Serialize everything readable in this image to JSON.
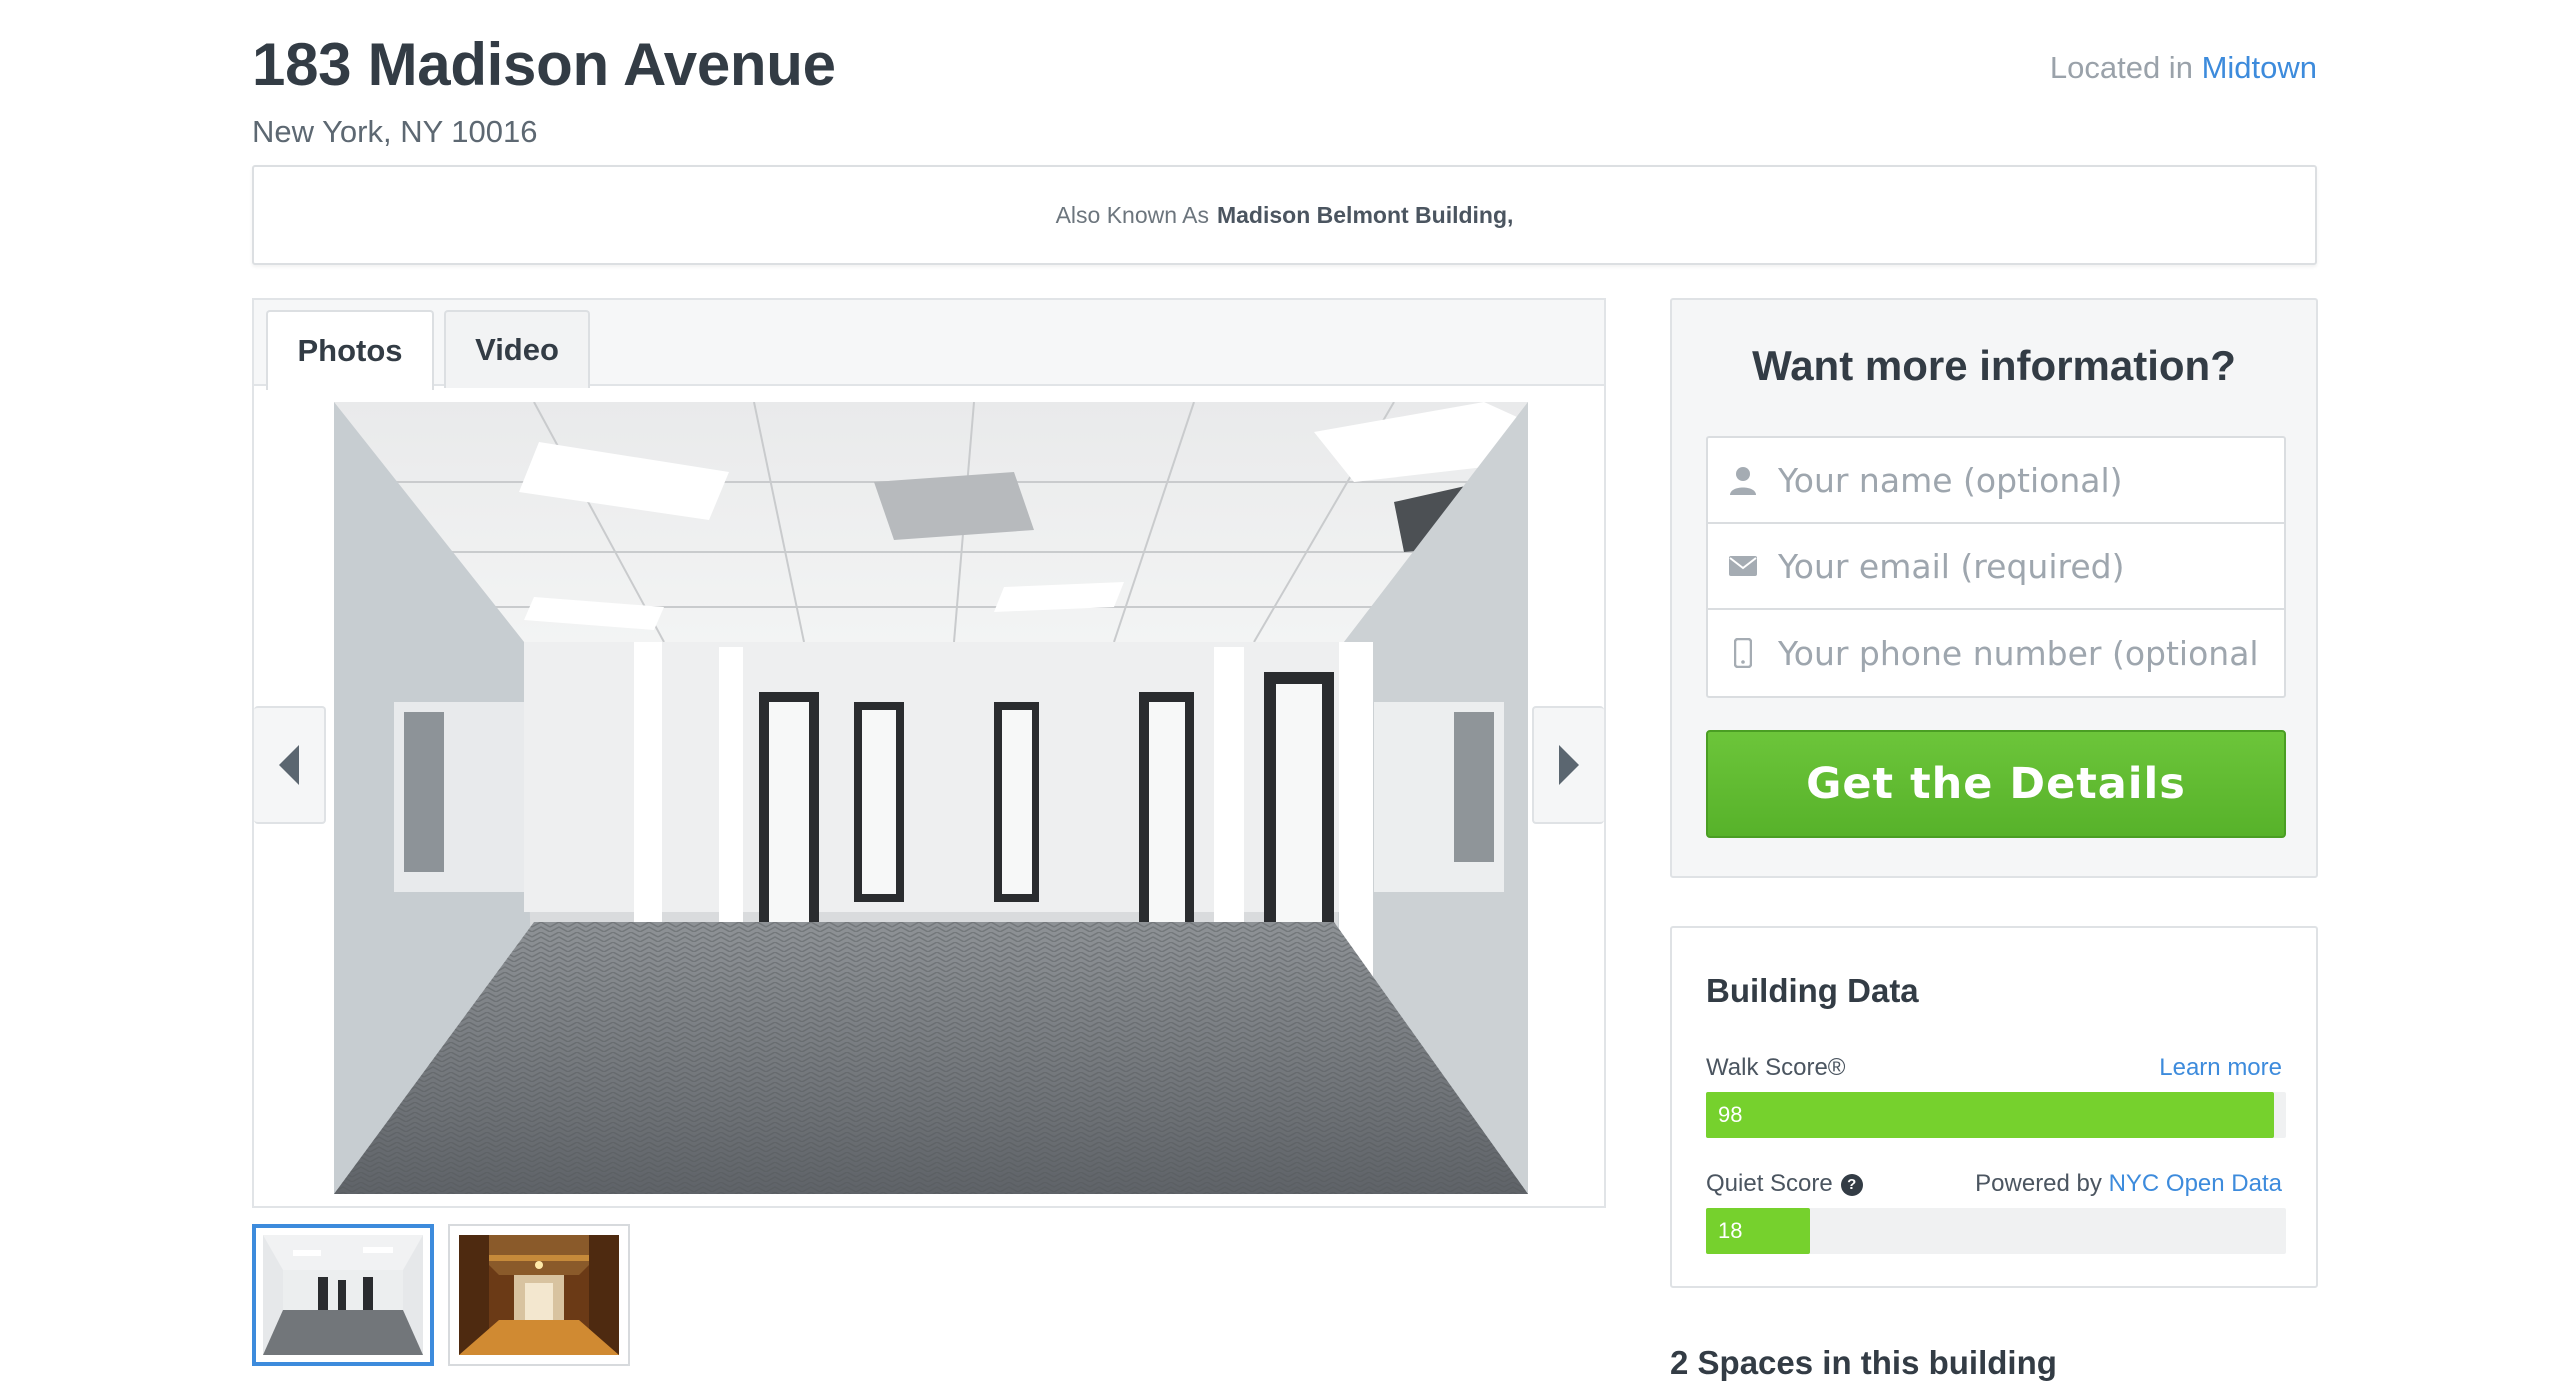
{
  "building": {
    "title": "183 Madison Avenue",
    "address": "New York, NY 10016",
    "located_prefix": "Located in",
    "neighborhood": "Midtown",
    "aka_prefix": "Also Known As",
    "aka_name": "Madison Belmont Building,"
  },
  "gallery": {
    "tabs": [
      {
        "label": "Photos",
        "active": true
      },
      {
        "label": "Video",
        "active": false
      }
    ],
    "thumbnails": [
      {
        "subject": "empty office interior",
        "active": true
      },
      {
        "subject": "ornate wood-paneled lobby",
        "active": false
      }
    ]
  },
  "info_form": {
    "heading": "Want more information?",
    "name_placeholder": "Your name (optional)",
    "email_placeholder": "Your email (required)",
    "phone_placeholder": "Your phone number (optional)",
    "submit_label": "Get the Details"
  },
  "building_data": {
    "heading": "Building Data",
    "walk_score_label": "Walk Score®",
    "learn_more": "Learn more",
    "walk_score": "98",
    "walk_score_fraction": 0.98,
    "quiet_score_label": "Quiet Score",
    "help_glyph": "?",
    "powered_by_prefix": "Powered by",
    "powered_by_link": "NYC Open Data",
    "quiet_score": "18",
    "quiet_score_fraction": 0.18
  },
  "spaces_heading": "2 Spaces in this building",
  "colors": {
    "accent_blue": "#3d8bdc",
    "cta_green": "#5fbb31",
    "score_green": "#76d12d",
    "heading_text": "#333c45"
  }
}
